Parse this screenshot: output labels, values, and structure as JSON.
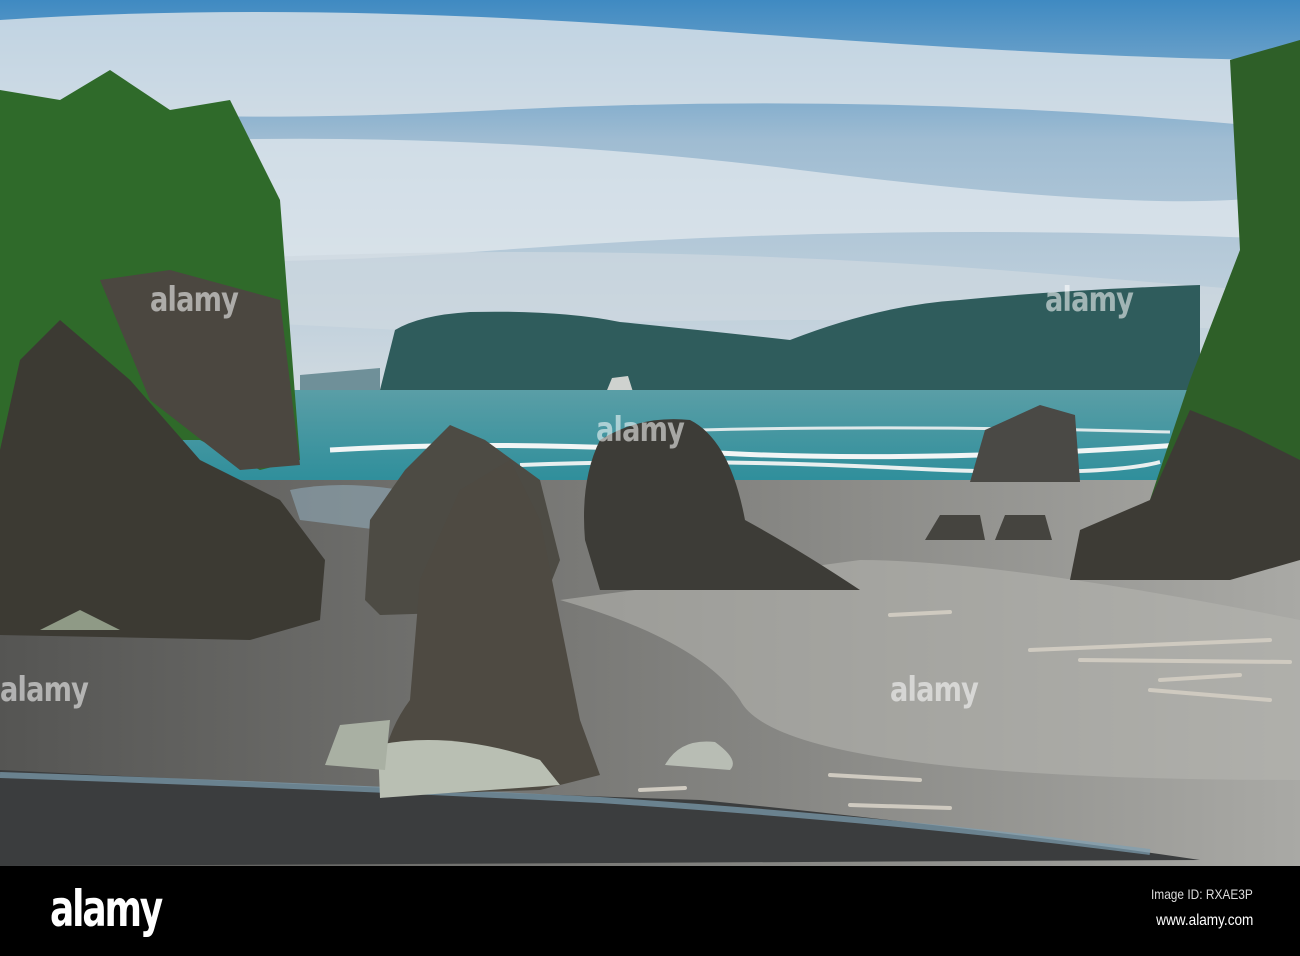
{
  "photo": {
    "subject": "coastal beach scene",
    "colors": {
      "sky": "#4f93c6",
      "cloud": "#d6dde3",
      "sea": "#3f9aa5",
      "sand": "#8f8f8c",
      "forest": "#2f6f2c",
      "rock": "#3f3d38"
    }
  },
  "watermark": {
    "text": "alamy"
  },
  "footer": {
    "logo": "alamy",
    "image_id": "Image ID: RXAE3P",
    "website": "www.alamy.com"
  }
}
